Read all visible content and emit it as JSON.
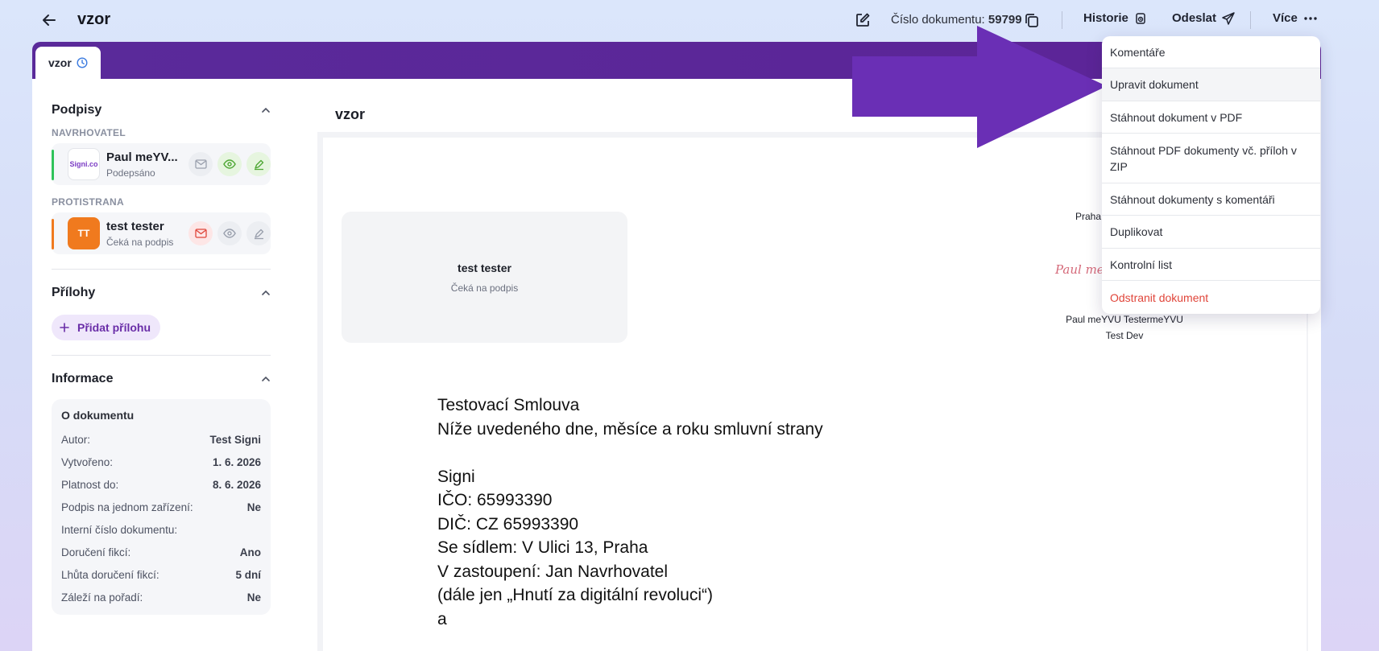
{
  "header": {
    "title": "vzor",
    "doc_number_label": "Číslo dokumentu:",
    "doc_number_value": "59799",
    "history_label": "Historie",
    "send_label": "Odeslat",
    "more_label": "Více"
  },
  "tab": {
    "label": "vzor"
  },
  "sidebar": {
    "signatures": {
      "heading": "Podpisy",
      "proposer_label": "NAVRHOVATEL",
      "proposer": {
        "name": "Paul meYV...",
        "status": "Podepsáno",
        "avatar_text": "Signi.co",
        "color": "#2fc35a"
      },
      "counterparty_label": "PROTISTRANA",
      "counterparty": {
        "name": "test tester",
        "status": "Čeká na podpis",
        "avatar_text": "TT",
        "color": "#f07a1e"
      }
    },
    "attachments": {
      "heading": "Přílohy",
      "add_label": "Přidat přílohu"
    },
    "info": {
      "heading": "Informace",
      "box_title": "O dokumentu",
      "rows": [
        {
          "label": "Autor:",
          "value": "Test Signi"
        },
        {
          "label": "Vytvořeno:",
          "value": "1. 6. 2026"
        },
        {
          "label": "Platnost do:",
          "value": "8. 6. 2026"
        },
        {
          "label": "Podpis na jednom zařízení:",
          "value": "Ne"
        },
        {
          "label": "Interní číslo dokumentu:",
          "value": ""
        },
        {
          "label": "Doručení fikcí:",
          "value": "Ano"
        },
        {
          "label": "Lhůta doručení fikcí:",
          "value": "5 dní"
        },
        {
          "label": "Záleží na pořadí:",
          "value": "Ne"
        }
      ]
    }
  },
  "document": {
    "name": "vzor",
    "pending_signer": {
      "name": "test tester",
      "status": "Čeká na podpis"
    },
    "signed_place": "Praha",
    "signature_script": "Paul meY",
    "signer_fullname": "Paul meYVU TestermeYVU",
    "signer_org": "Test Dev",
    "contract_lines": [
      "Testovací Smlouva",
      "Níže uvedeného dne, měsíce a roku smluvní strany",
      "",
      "Signi",
      "IČO: 65993390",
      "DIČ: CZ 65993390",
      "Se sídlem: V Ulici 13, Praha",
      "V zastoupení: Jan Navrhovatel",
      "(dále jen „Hnutí za digitální revoluci“)",
      "a"
    ]
  },
  "menu": {
    "items": [
      {
        "label": "Komentáře"
      },
      {
        "label": "Upravit dokument"
      },
      {
        "label": "Stáhnout dokument v PDF"
      },
      {
        "label": "Stáhnout PDF dokumenty vč. příloh v ZIP"
      },
      {
        "label": "Stáhnout dokumenty s komentáři"
      },
      {
        "label": "Duplikovat"
      },
      {
        "label": "Kontrolní list"
      },
      {
        "label": "Odstranit dokument"
      }
    ]
  },
  "colors": {
    "accent_purple": "#5a2a9a",
    "arrow_purple": "#6a2fb5",
    "danger": "#e0453a"
  }
}
